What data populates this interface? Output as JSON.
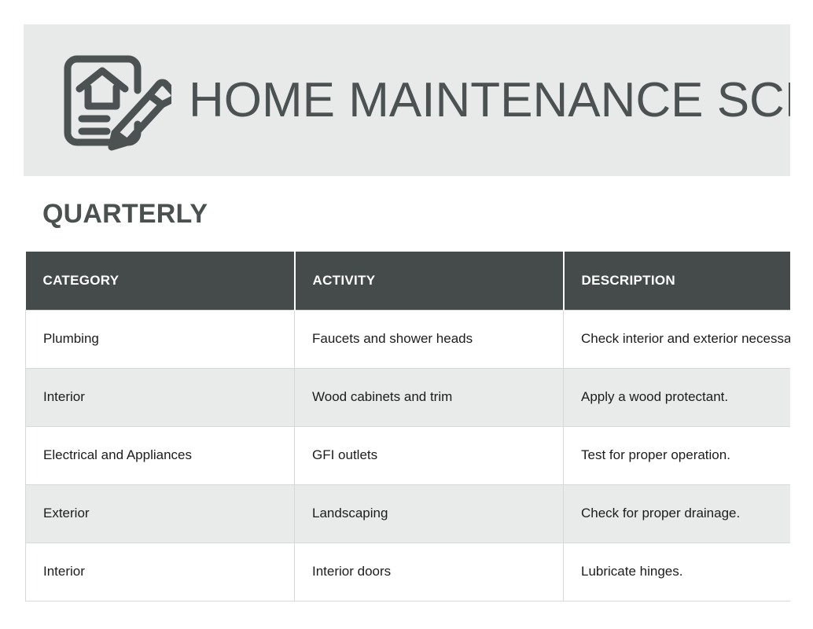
{
  "document": {
    "title": "HOME MAINTENANCE SCH",
    "icon": "home-document-pencil-icon",
    "section_heading": "QUARTERLY"
  },
  "colors": {
    "banner_background": "#e8eaea",
    "banner_text": "#4c5252",
    "heading_text": "#4b5150",
    "table_header_background": "#454b4b",
    "table_header_text": "#ffffff",
    "row_alt_background": "#e9ebeb",
    "row_background": "#ffffff",
    "cell_text": "#1c1c1c",
    "border": "#d6d9d9"
  },
  "table": {
    "columns": [
      {
        "key": "category",
        "label": "CATEGORY"
      },
      {
        "key": "activity",
        "label": "ACTIVITY"
      },
      {
        "key": "description",
        "label": "DESCRIPTION"
      }
    ],
    "rows": [
      {
        "category": "Plumbing",
        "activity": "Faucets and shower heads",
        "description": "Check interior and exterior necessary."
      },
      {
        "category": "Interior",
        "activity": "Wood cabinets and trim",
        "description": "Apply a wood protectant."
      },
      {
        "category": "Electrical and Appliances",
        "activity": "GFI outlets",
        "description": "Test for proper operation."
      },
      {
        "category": "Exterior",
        "activity": "Landscaping",
        "description": "Check for proper drainage."
      },
      {
        "category": "Interior",
        "activity": "Interior doors",
        "description": "Lubricate hinges."
      }
    ]
  }
}
